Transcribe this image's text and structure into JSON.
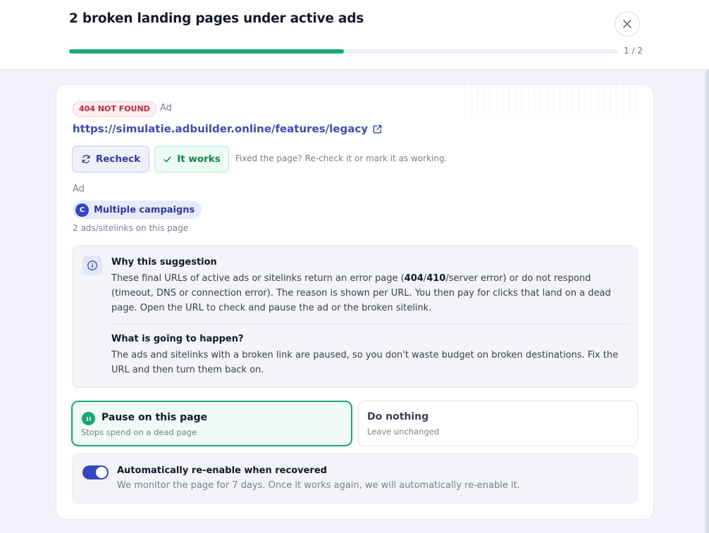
{
  "header": {
    "title": "2 broken landing pages under active ads",
    "close_icon": "close-icon",
    "progress": {
      "current": 1,
      "total": 2,
      "fraction": 0.5,
      "label": "1 / 2"
    },
    "accent_color": "#17a874"
  },
  "card": {
    "status_badge": "404 NOT FOUND",
    "kind": "Ad",
    "url": "https://simulatie.adbuilder.online/features/legacy",
    "url_icon": "external-link-icon",
    "buttons": {
      "recheck": "Recheck",
      "recheck_icon": "refresh-icon",
      "works": "It works",
      "works_icon": "check-icon"
    },
    "hint": "Fixed the page? Re-check it or mark it as working.",
    "section_label": "Ad",
    "campaign_chip": {
      "avatar": "C",
      "label": "Multiple campaigns"
    },
    "ads_count": "2 ads/sitelinks on this page"
  },
  "info": {
    "icon": "info-icon",
    "why_title": "Why this suggestion",
    "why_text_1": "These final URLs of active ads or sitelinks return an error page (",
    "why_code_1": "404",
    "why_sep": "/",
    "why_code_2": "410",
    "why_text_2": "/server error) or do not respond (timeout, DNS or connection error). The reason is shown per URL. You then pay for clicks that land on a dead page. Open the URL to check and pause the ad or the broken sitelink.",
    "what_title": "What is going to happen?",
    "what_text": "The ads and sitelinks with a broken link are paused, so you don't waste budget on broken destinations. Fix the URL and then turn them back on."
  },
  "options": {
    "selected": "pause",
    "pause": {
      "title": "Pause on this page",
      "subtitle": "Stops spend on a dead page",
      "icon": "pause-icon"
    },
    "nothing": {
      "title": "Do nothing",
      "subtitle": "Leave unchanged"
    }
  },
  "auto_reenable": {
    "enabled": true,
    "title": "Automatically re-enable when recovered",
    "description": "We monitor the page for 7 days. Once it works again, we will automatically re-enable it."
  }
}
